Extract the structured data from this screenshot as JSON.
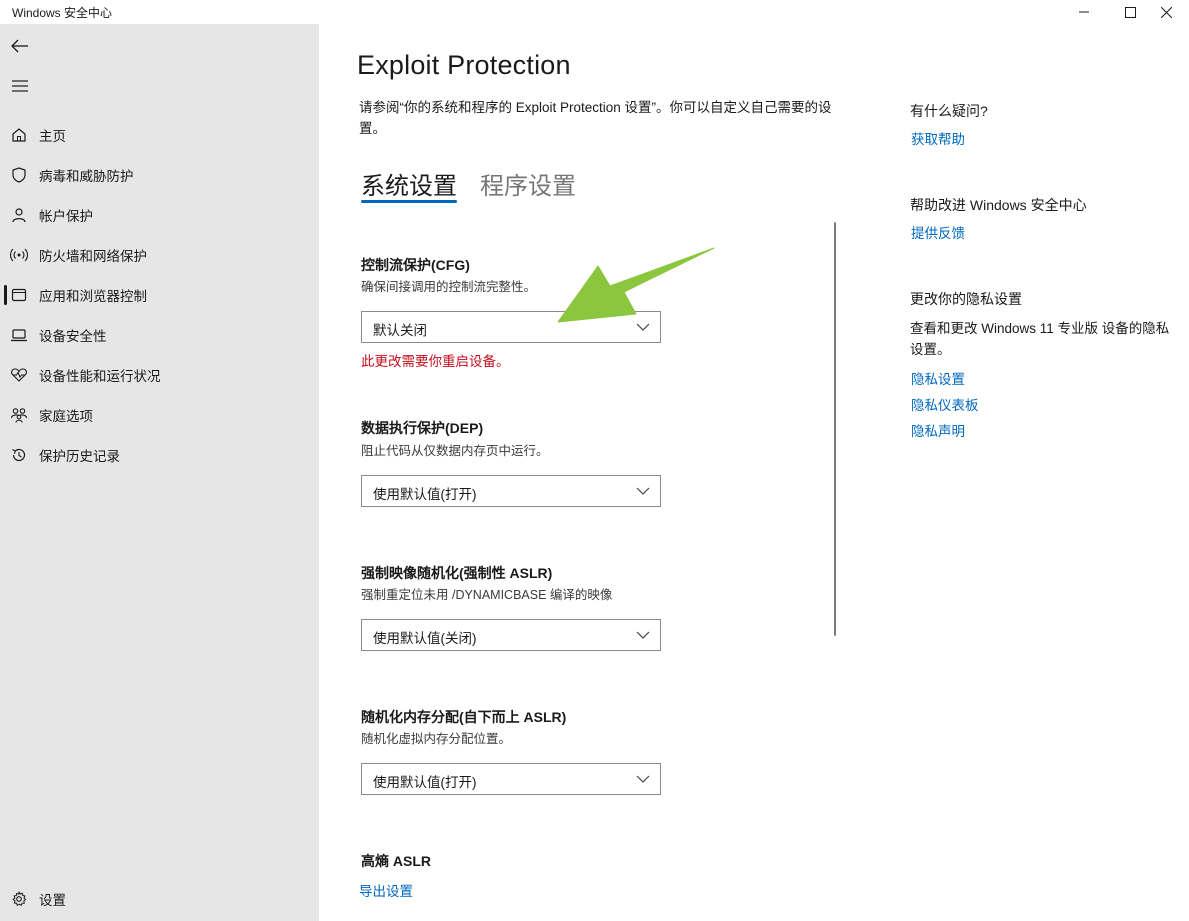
{
  "window": {
    "title": "Windows 安全中心"
  },
  "sidebar": {
    "items": [
      {
        "label": "主页",
        "icon": "home-icon"
      },
      {
        "label": "病毒和威胁防护",
        "icon": "shield-icon"
      },
      {
        "label": "帐户保护",
        "icon": "person-icon"
      },
      {
        "label": "防火墙和网络保护",
        "icon": "wifi-icon"
      },
      {
        "label": "应用和浏览器控制",
        "icon": "app-window-icon",
        "active": true
      },
      {
        "label": "设备安全性",
        "icon": "laptop-icon"
      },
      {
        "label": "设备性能和运行状况",
        "icon": "heart-pulse-icon"
      },
      {
        "label": "家庭选项",
        "icon": "family-icon"
      },
      {
        "label": "保护历史记录",
        "icon": "history-icon"
      }
    ],
    "settings_label": "设置"
  },
  "main": {
    "title": "Exploit Protection",
    "description": "请参阅“你的系统和程序的 Exploit Protection 设置”。你可以自定义自己需要的设置。",
    "tabs": [
      {
        "label": "系统设置",
        "selected": true
      },
      {
        "label": "程序设置",
        "selected": false
      }
    ],
    "settings": [
      {
        "title": "控制流保护(CFG)",
        "desc": "确保间接调用的控制流完整性。",
        "value": "默认关闭",
        "warning": "此更改需要你重启设备。"
      },
      {
        "title": "数据执行保护(DEP)",
        "desc": "阻止代码从仅数据内存页中运行。",
        "value": "使用默认值(打开)"
      },
      {
        "title": "强制映像随机化(强制性 ASLR)",
        "desc": "强制重定位未用 /DYNAMICBASE 编译的映像",
        "value": "使用默认值(关闭)"
      },
      {
        "title": "随机化内存分配(自下而上 ASLR)",
        "desc": "随机化虚拟内存分配位置。",
        "value": "使用默认值(打开)"
      },
      {
        "title": "高熵 ASLR",
        "desc": ""
      }
    ],
    "export_label": "导出设置"
  },
  "right_pane": {
    "help_heading": "有什么疑问?",
    "help_link": "获取帮助",
    "improve_heading": "帮助改进 Windows 安全中心",
    "feedback_link": "提供反馈",
    "privacy_heading": "更改你的隐私设置",
    "privacy_text": "查看和更改 Windows 11 专业版 设备的隐私设置。",
    "privacy_links": [
      "隐私设置",
      "隐私仪表板",
      "隐私声明"
    ]
  },
  "colors": {
    "accent": "#0067c0",
    "warning": "#c50f1f",
    "sidebar_bg": "#e6e6e6",
    "annotation_arrow": "#8cc63f"
  }
}
